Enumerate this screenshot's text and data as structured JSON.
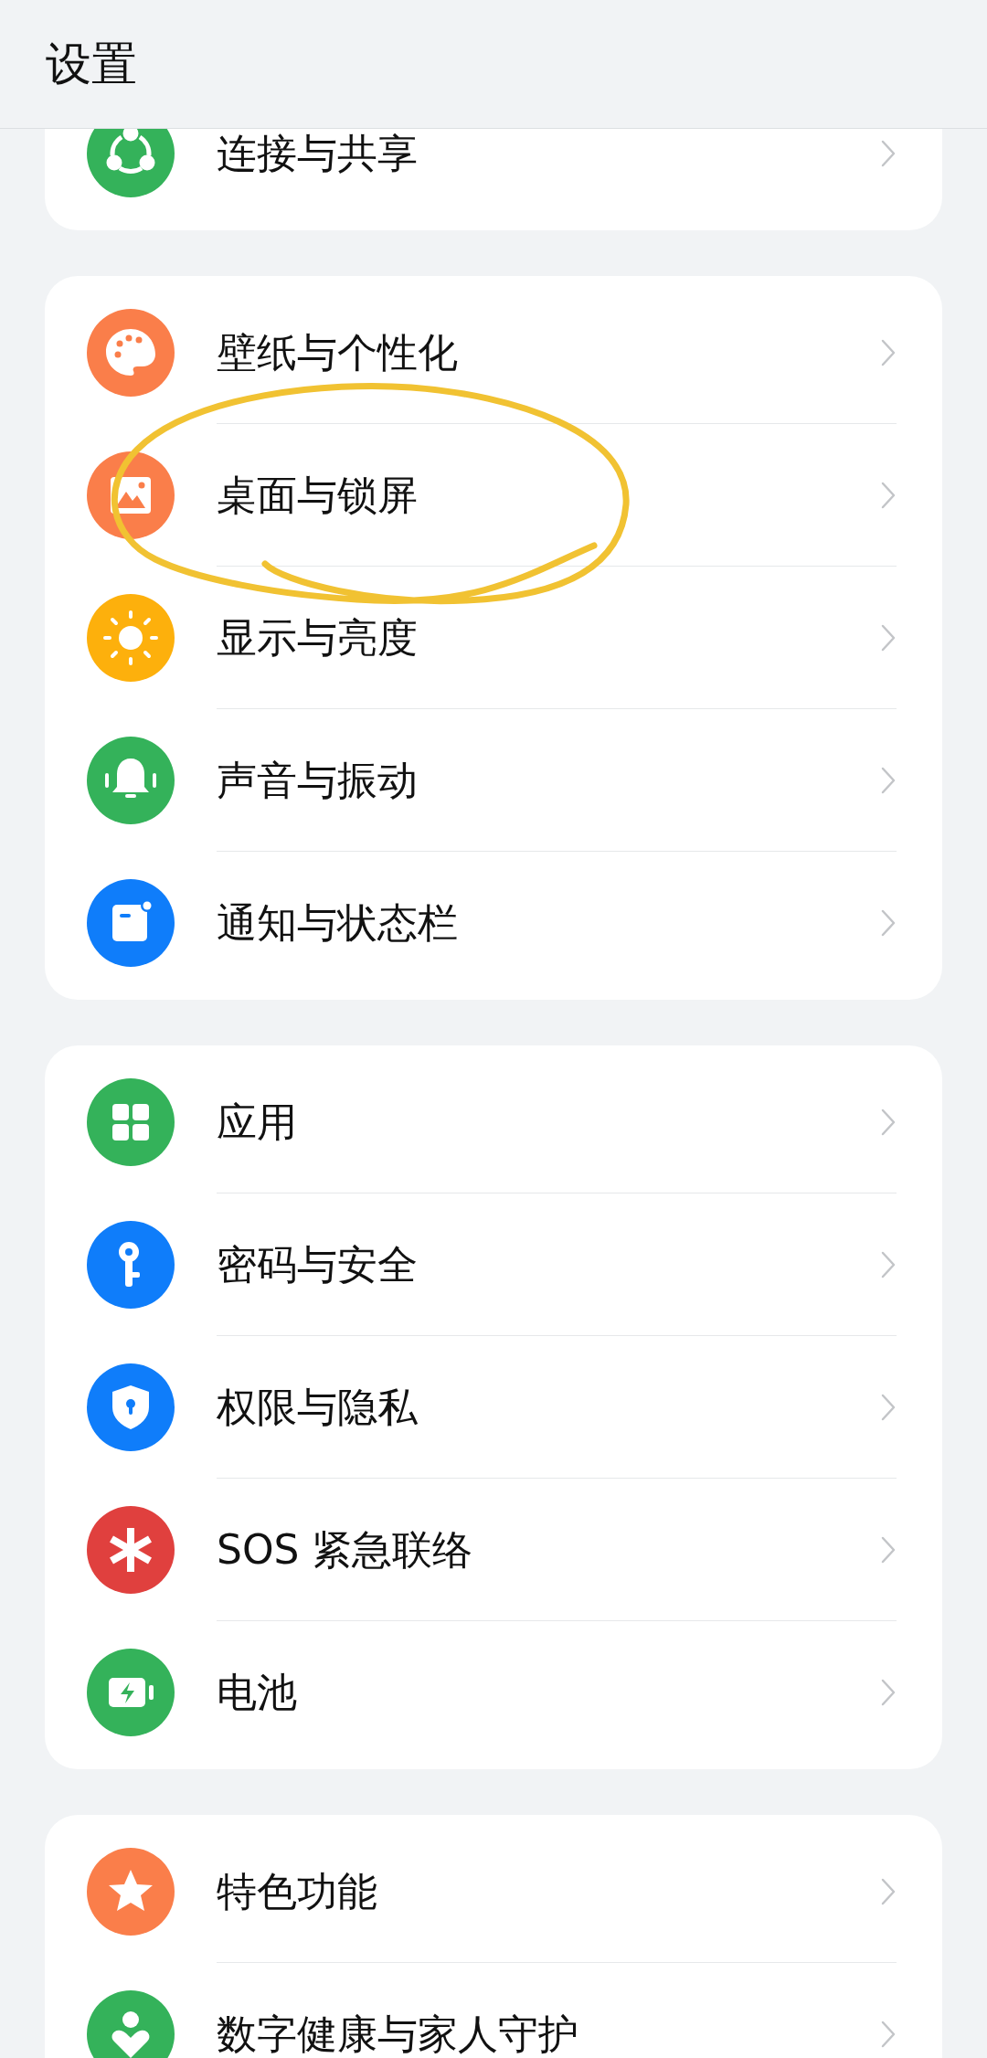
{
  "header": {
    "title": "设置"
  },
  "groups": [
    {
      "items": [
        {
          "label": "连接与共享",
          "color": "#34b25a"
        }
      ]
    },
    {
      "items": [
        {
          "label": "壁纸与个性化",
          "color": "#fa7e4a"
        },
        {
          "label": "桌面与锁屏",
          "color": "#fa7e4a"
        },
        {
          "label": "显示与亮度",
          "color": "#fdb00c"
        },
        {
          "label": "声音与振动",
          "color": "#34b25a"
        },
        {
          "label": "通知与状态栏",
          "color": "#0f7dfa"
        }
      ]
    },
    {
      "items": [
        {
          "label": "应用",
          "color": "#34b25a"
        },
        {
          "label": "密码与安全",
          "color": "#0f7dfa"
        },
        {
          "label": "权限与隐私",
          "color": "#0f7dfa"
        },
        {
          "label": "SOS 紧急联络",
          "color": "#e0403e"
        },
        {
          "label": "电池",
          "color": "#34b25a"
        }
      ]
    },
    {
      "items": [
        {
          "label": "特色功能",
          "color": "#fa7e4a"
        },
        {
          "label": "数字健康与家人守护",
          "color": "#34b25a"
        }
      ]
    }
  ]
}
